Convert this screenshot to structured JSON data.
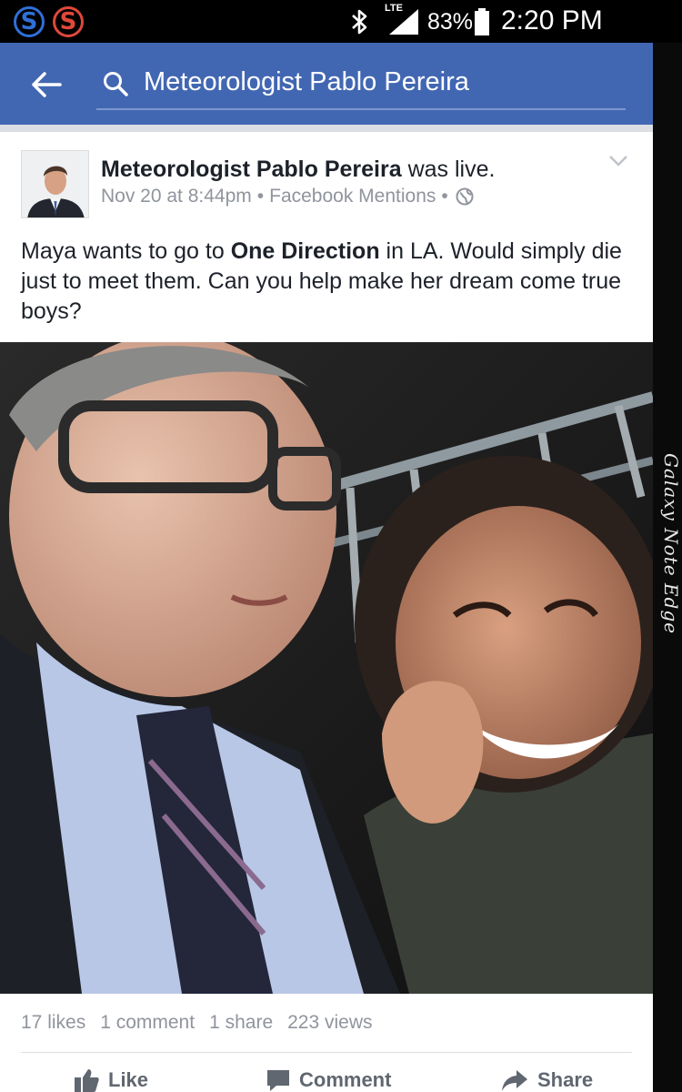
{
  "status_bar": {
    "app_icons": [
      "S",
      "S"
    ],
    "network": "LTE",
    "battery": "83%",
    "time": "2:20 PM"
  },
  "header": {
    "search_query": "Meteorologist Pablo Pereira",
    "accent_color": "#4267b2"
  },
  "post": {
    "author": "Meteorologist Pablo Pereira",
    "author_suffix": " was live.",
    "timestamp": "Nov 20 at 8:44pm",
    "source": "Facebook Mentions",
    "separator": "•",
    "text_before": "Maya wants to go to ",
    "text_bold": "One Direction",
    "text_after": " in LA. Would simply die just to meet them. Can you help make her dream come true boys?",
    "stats": {
      "likes": "17 likes",
      "comments": "1 comment",
      "shares": "1 share",
      "views": "223 views"
    },
    "actions": {
      "like": "Like",
      "comment": "Comment",
      "share": "Share"
    }
  },
  "device_edge_label": "Galaxy Note Edge"
}
